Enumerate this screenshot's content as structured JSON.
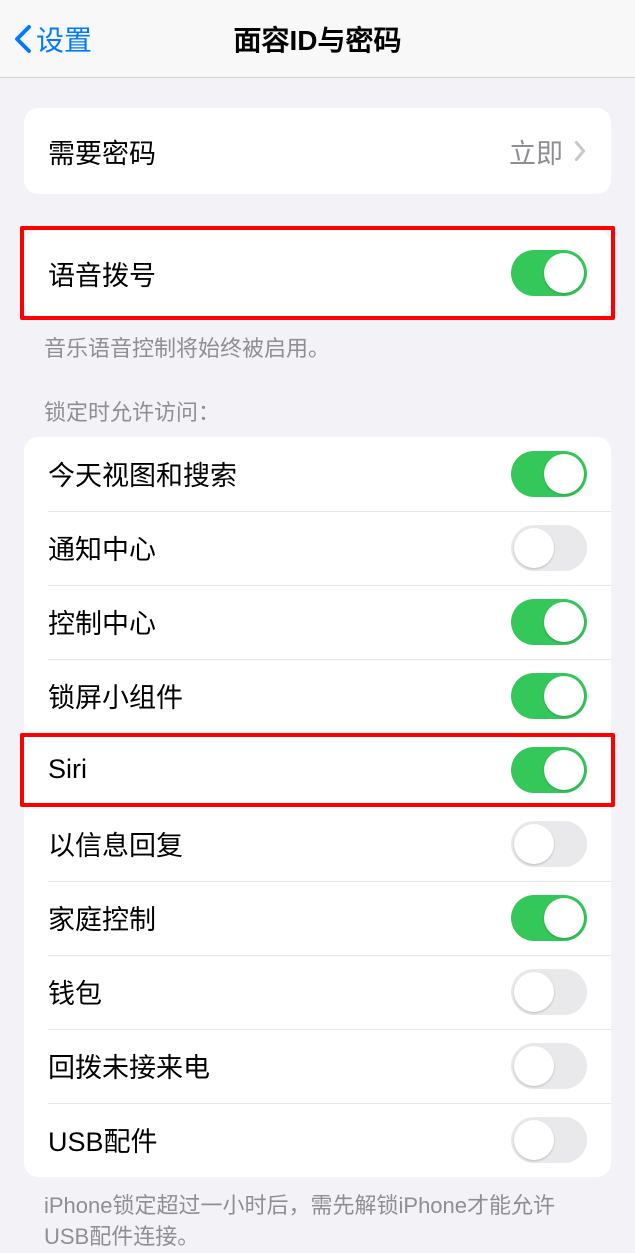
{
  "header": {
    "back_label": "设置",
    "title": "面容ID与密码"
  },
  "require_passcode": {
    "label": "需要密码",
    "value": "立即"
  },
  "voice_dial": {
    "label": "语音拨号",
    "enabled": true,
    "footer": "音乐语音控制将始终被启用。"
  },
  "lock_section_header": "锁定时允许访问：",
  "lock_items": [
    {
      "label": "今天视图和搜索",
      "enabled": true
    },
    {
      "label": "通知中心",
      "enabled": false
    },
    {
      "label": "控制中心",
      "enabled": true
    },
    {
      "label": "锁屏小组件",
      "enabled": true
    },
    {
      "label": "Siri",
      "enabled": true
    },
    {
      "label": "以信息回复",
      "enabled": false
    },
    {
      "label": "家庭控制",
      "enabled": true
    },
    {
      "label": "钱包",
      "enabled": false
    },
    {
      "label": "回拨未接来电",
      "enabled": false
    },
    {
      "label": "USB配件",
      "enabled": false
    }
  ],
  "usb_footer": "iPhone锁定超过一小时后，需先解锁iPhone才能允许USB配件连接。"
}
